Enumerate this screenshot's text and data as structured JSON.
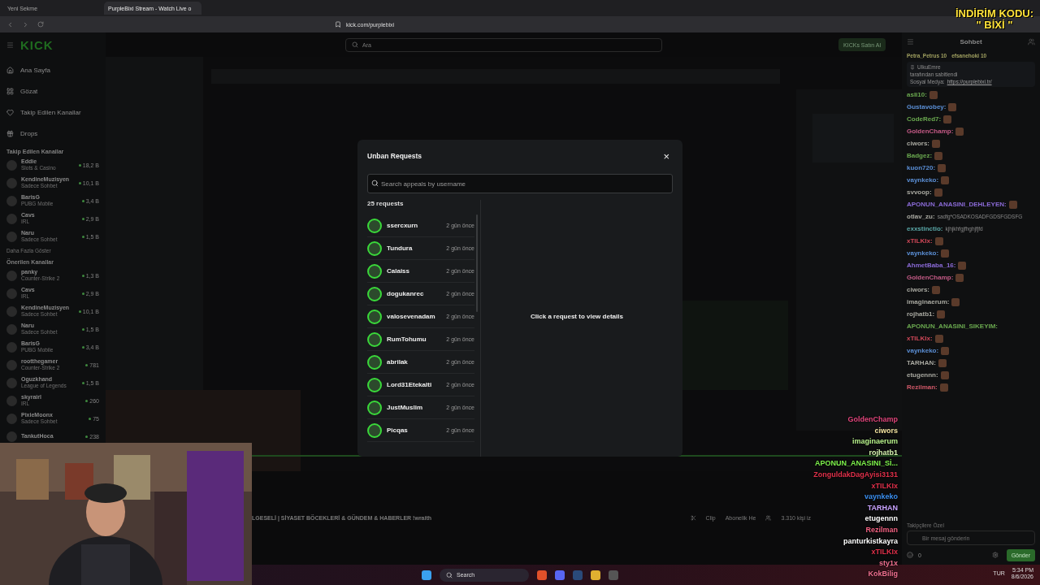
{
  "browser": {
    "tabs": [
      {
        "label": "Yeni Sekme",
        "selected": false
      },
      {
        "label": "PurpleBixi Stream - Watch Live o",
        "selected": true
      }
    ],
    "url": "kick.com/purplebixi"
  },
  "promo": {
    "line1": "İNDİRİM KODU:",
    "line2": "\" BİXİ \""
  },
  "header": {
    "logo": "KICK",
    "search_placeholder": "Ara",
    "buy_button": "KICKs Satın Al"
  },
  "sidebar": {
    "nav": [
      {
        "label": "Ana Sayfa",
        "kind": "home"
      },
      {
        "label": "Gözat",
        "kind": "browse"
      },
      {
        "label": "Takip Edilen Kanallar",
        "kind": "heart"
      },
      {
        "label": "Drops",
        "kind": "drops"
      }
    ],
    "followed_title": "Takip Edilen Kanallar",
    "followed": [
      {
        "name": "Eddie",
        "category": "Slots & Casino",
        "viewers": "18,2 B"
      },
      {
        "name": "KendineMuzisyen",
        "category": "Sadece Sohbet",
        "viewers": "10,1 B"
      },
      {
        "name": "BarisG",
        "category": "PUBG Mobile",
        "viewers": "3,4 B"
      },
      {
        "name": "Cavs",
        "category": "IRL",
        "viewers": "2,9 B"
      },
      {
        "name": "Naru",
        "category": "Sadece Sohbet",
        "viewers": "1,5 B"
      }
    ],
    "show_more": "Daha Fazla Göster",
    "recommended_title": "Önerilen Kanallar",
    "recommended": [
      {
        "name": "panky",
        "category": "Counter-Strike 2",
        "viewers": "1,3 B"
      },
      {
        "name": "Cavs",
        "category": "IRL",
        "viewers": "2,9 B"
      },
      {
        "name": "KendineMuzisyen",
        "category": "Sadece Sohbet",
        "viewers": "10,1 B"
      },
      {
        "name": "Naru",
        "category": "Sadece Sohbet",
        "viewers": "1,5 B"
      },
      {
        "name": "BarisG",
        "category": "PUBG Mobile",
        "viewers": "3,4 B"
      },
      {
        "name": "rootthegamer",
        "category": "Counter-Strike 2",
        "viewers": "781"
      },
      {
        "name": "Oguzkhand",
        "category": "League of Legends",
        "viewers": "1,5 B"
      },
      {
        "name": "skyrairl",
        "category": "IRL",
        "viewers": "260"
      },
      {
        "name": "PixieMoonx",
        "category": "Sadece Sohbet",
        "viewers": "75"
      },
      {
        "name": "TankutHoca",
        "viewers": "238"
      }
    ]
  },
  "stream": {
    "title": "LGESELİ | SİYASET BÖCEKLERİ & GÜNDEM & HABERLER !wraith",
    "clip": "Clip",
    "subscribe": "Abonelik He",
    "viewers": "3.310 kişi iz"
  },
  "modal": {
    "title": "Unban Requests",
    "close": "×",
    "search_placeholder": "Search appeals by username",
    "count": "25 requests",
    "empty": "Click a request to view details",
    "requests": [
      {
        "name": "ssercxurn",
        "time": "2 gün önce"
      },
      {
        "name": "Tundura",
        "time": "2 gün önce"
      },
      {
        "name": "Calaiss",
        "time": "2 gün önce"
      },
      {
        "name": "dogukanrec",
        "time": "2 gün önce"
      },
      {
        "name": "valosevenadam",
        "time": "2 gün önce"
      },
      {
        "name": "RumTohumu",
        "time": "2 gün önce"
      },
      {
        "name": "abrilak",
        "time": "2 gün önce"
      },
      {
        "name": "Lord31Etekalti",
        "time": "2 gün önce"
      },
      {
        "name": "JustMuslim",
        "time": "2 gün önce"
      },
      {
        "name": "Picqas",
        "time": "2 gün önce"
      }
    ]
  },
  "chat": {
    "title": "Sohbet",
    "top_gifters": [
      {
        "name": "Petra_Petrus",
        "count": "10"
      },
      {
        "name": "efsanehoki",
        "count": "10"
      }
    ],
    "pinned": {
      "author": "UlkuEmre",
      "note": "tarafından sabitlendi",
      "label": "Sosyal Medya:",
      "link": "https://purplebixi.tr/"
    },
    "messages": [
      {
        "user": "asli10:",
        "color": "#6aa84f",
        "emote": true
      },
      {
        "user": "Gustavobey:",
        "color": "#5b8fd6",
        "emote": true
      },
      {
        "user": "CodeRed7:",
        "color": "#6aa84f",
        "emote": true
      },
      {
        "user": "GoldenChamp:",
        "color": "#c45a86",
        "emote": true
      },
      {
        "user": "ciwors:",
        "color": "#a8a8a0",
        "emote": true
      },
      {
        "user": "Badgez:",
        "color": "#6aa84f",
        "emote": true
      },
      {
        "user": "kuon720:",
        "color": "#5b8fd6",
        "emote": true
      },
      {
        "user": "vaynkeko:",
        "color": "#5b8fd6",
        "emote": true
      },
      {
        "user": "svvoop:",
        "color": "#a8a8a0",
        "emote": true
      },
      {
        "user": "APONUN_ANASINI_DEHLEYEN:",
        "color": "#8a6ad6",
        "emote": true
      },
      {
        "user": "otlav_zu:",
        "color": "#a8a8a0",
        "text": "sadfg*OSADKOSADFGDSFGDSFG",
        "emote": false
      },
      {
        "user": "exxstinctio:",
        "color": "#5aa8a8",
        "text": "kjhjkhfgjfhghjfjfd",
        "emote": false
      },
      {
        "user": "xTILKIx:",
        "color": "#d04858",
        "emote": true
      },
      {
        "user": "vaynkeko:",
        "color": "#5b8fd6",
        "emote": true
      },
      {
        "user": "AhmetBaba_16:",
        "color": "#8a6ad6",
        "emote": true
      },
      {
        "user": "GoldenChamp:",
        "color": "#c45a86",
        "emote": true
      },
      {
        "user": "ciwors:",
        "color": "#a8a8a0",
        "emote": true
      },
      {
        "user": "imaginaerum:",
        "color": "#a8a8a0",
        "emote": true
      },
      {
        "user": "rojhatb1:",
        "color": "#a8a8a0",
        "emote": true
      },
      {
        "user": "APONUN_ANASINI_SIKEYIM:",
        "color": "#6aa84f",
        "emote": false
      },
      {
        "user": "xTILKIx:",
        "color": "#d04858",
        "emote": true
      },
      {
        "user": "vaynkeko:",
        "color": "#5b8fd6",
        "emote": true
      },
      {
        "user": "TARHAN:",
        "color": "#a8a8a0",
        "emote": true
      },
      {
        "user": "etugennn:",
        "color": "#a8a8a0",
        "emote": true
      },
      {
        "user": "Rezilman:",
        "color": "#d05868",
        "emote": true
      }
    ],
    "followers_only": "Takipçilere Özel",
    "input_placeholder": "Bir mesaj gönderin",
    "points": "0",
    "send": "Gönder"
  },
  "overlay_chat": [
    {
      "name": "GoldenChamp",
      "color": "#e0457b"
    },
    {
      "name": "ciwors",
      "color": "#f3e3a0"
    },
    {
      "name": "imaginaerum",
      "color": "#b6f08a"
    },
    {
      "name": "rojhatb1",
      "color": "#d8f5b0"
    },
    {
      "name": "APONUN_ANASINI_Sİ...",
      "color": "#7cf04a"
    },
    {
      "name": "ZonguldakDagAyisi3131",
      "color": "#e0304a"
    },
    {
      "name": "xTILKIx",
      "color": "#e0304a"
    },
    {
      "name": "vaynkeko",
      "color": "#3b8ff0"
    },
    {
      "name": "TARHAN",
      "color": "#c9a3ff"
    },
    {
      "name": "etugennn",
      "color": "#ffffff"
    },
    {
      "name": "Rezilman",
      "color": "#f06080"
    },
    {
      "name": "panturkistkayra",
      "color": "#ffffff"
    },
    {
      "name": "xTILKIx",
      "color": "#e0304a"
    },
    {
      "name": "sty1x",
      "color": "#f07090"
    },
    {
      "name": "KokBilig",
      "color": "#f07090"
    }
  ],
  "taskbar": {
    "search": "Search",
    "language": "TUR",
    "time": "5:34 PM",
    "date": "8/6/2026"
  }
}
